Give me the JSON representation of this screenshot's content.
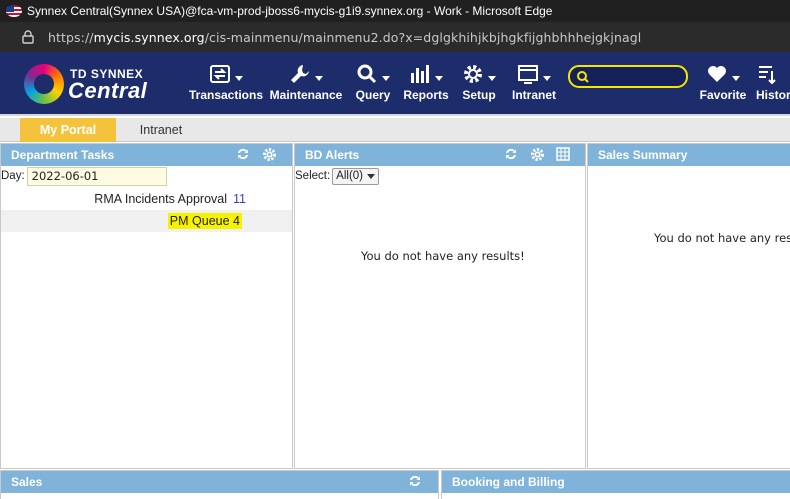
{
  "window": {
    "title": "Synnex Central(Synnex USA)@fca-vm-prod-jboss6-mycis-g1i9.synnex.org - Work - Microsoft Edge"
  },
  "address": {
    "scheme": "https://",
    "domain": "mycis.synnex.org",
    "path": "/cis-mainmenu/mainmenu2.do?x=dglgkhihjkbjhgkfijghbhhhejgkjnagl"
  },
  "brand": {
    "line1": "TD SYNNEX",
    "line2": "Central"
  },
  "nav": {
    "transactions": "Transactions",
    "maintenance": "Maintenance",
    "query": "Query",
    "reports": "Reports",
    "setup": "Setup",
    "intranet": "Intranet",
    "favorite": "Favorite",
    "history": "History"
  },
  "tabs": {
    "my_portal": "My Portal",
    "intranet": "Intranet"
  },
  "department_tasks": {
    "title": "Department Tasks",
    "day_label": "Day:",
    "day_value": "2022-06-01",
    "rows": [
      {
        "label": "RMA Incidents Approval",
        "count": "11"
      },
      {
        "label": "PM Queue",
        "count": "4"
      }
    ]
  },
  "bd_alerts": {
    "title": "BD Alerts",
    "select_label": "Select:",
    "select_value": "All(0)",
    "empty": "You do not have any results!"
  },
  "sales_summary": {
    "title": "Sales Summary",
    "empty": "You do not have any resu"
  },
  "sales": {
    "title": "Sales"
  },
  "booking_billing": {
    "title": "Booking and Billing"
  },
  "icons": {
    "refresh": "refresh-icon",
    "settings": "gear-icon",
    "export": "grid-export-icon"
  }
}
